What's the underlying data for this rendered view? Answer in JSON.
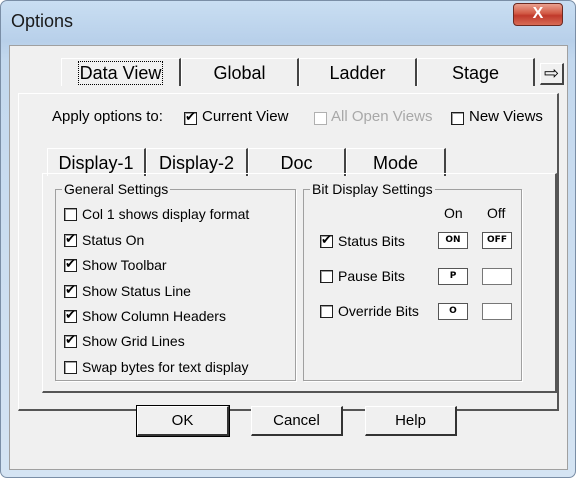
{
  "window": {
    "title": "Options",
    "close_label": "X"
  },
  "tabs": [
    "Data View",
    "Global",
    "Ladder",
    "Stage"
  ],
  "scroll_arrow": "⇨",
  "apply": {
    "label": "Apply options to:",
    "current_view": "Current View",
    "all_open_views": "All Open Views",
    "new_views": "New Views",
    "state": {
      "current_view": true,
      "all_open_views": false,
      "new_views": false
    }
  },
  "inner_tabs": [
    "Display-1",
    "Display-2",
    "Doc",
    "Mode"
  ],
  "general": {
    "title": "General Settings",
    "items": [
      {
        "label": "Col 1 shows display format",
        "checked": false
      },
      {
        "label": "Status On",
        "checked": true
      },
      {
        "label": "Show Toolbar",
        "checked": true
      },
      {
        "label": "Show Status Line",
        "checked": true
      },
      {
        "label": "Show Column Headers",
        "checked": true
      },
      {
        "label": "Show Grid Lines",
        "checked": true
      },
      {
        "label": "Swap bytes for text display",
        "checked": false
      }
    ]
  },
  "bit": {
    "title": "Bit Display Settings",
    "col_on": "On",
    "col_off": "Off",
    "items": [
      {
        "label": "Status Bits",
        "checked": true,
        "on": "ON",
        "off": "OFF"
      },
      {
        "label": "Pause Bits",
        "checked": false,
        "on": "P",
        "off": ""
      },
      {
        "label": "Override Bits",
        "checked": false,
        "on": "O",
        "off": ""
      }
    ]
  },
  "buttons": {
    "ok": "OK",
    "cancel": "Cancel",
    "help": "Help"
  }
}
